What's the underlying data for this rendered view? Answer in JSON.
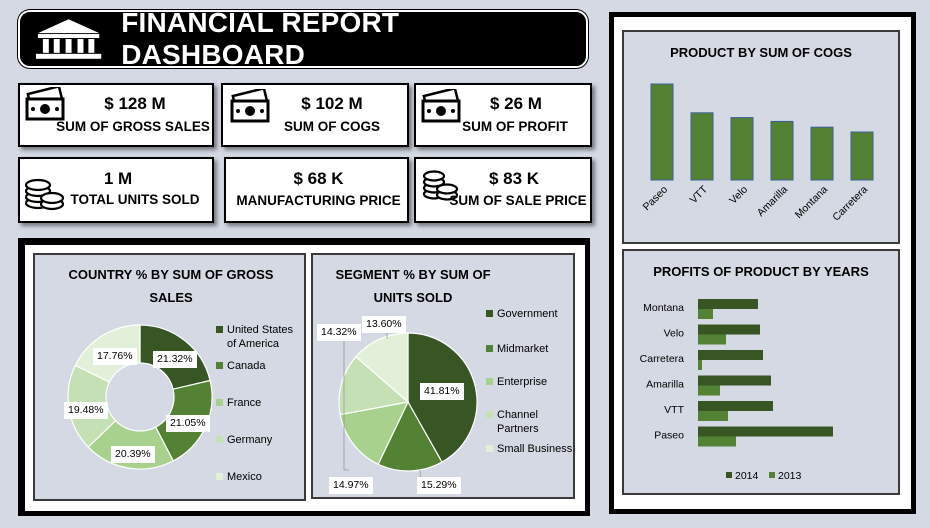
{
  "header": {
    "title": "FINANCIAL REPORT DASHBOARD"
  },
  "kpis": [
    {
      "value": "$ 128 M",
      "label": "SUM OF GROSS SALES",
      "icon": "cash-icon"
    },
    {
      "value": "$ 102 M",
      "label": "SUM OF COGS",
      "icon": "cash-icon"
    },
    {
      "value": "$ 26 M",
      "label": "SUM OF PROFIT",
      "icon": "cash-icon"
    },
    {
      "value": "1 M",
      "label": "TOTAL UNITS SOLD",
      "icon": "coins-icon"
    },
    {
      "value": "$ 68 K",
      "label": "MANUFACTURING PRICE",
      "icon": ""
    },
    {
      "value": "$ 83 K",
      "label": "SUM OF SALE PRICE",
      "icon": "coins-icon"
    }
  ],
  "chart_data": [
    {
      "type": "pie",
      "variant": "donut",
      "title": "COUNTRY % BY SUM OF GROSS SALES",
      "categories": [
        "United States of America",
        "Canada",
        "France",
        "Germany",
        "Mexico"
      ],
      "values": [
        21.32,
        21.05,
        20.39,
        19.48,
        17.76
      ],
      "data_labels": [
        "21.32%",
        "21.05%",
        "20.39%",
        "19.48%",
        "17.76%"
      ],
      "colors": [
        "#375623",
        "#548235",
        "#a9d18e",
        "#c5e0b4",
        "#e2f0d9"
      ],
      "legend_position": "right"
    },
    {
      "type": "pie",
      "title": "SEGMENT % BY SUM OF UNITS SOLD",
      "categories": [
        "Government",
        "Midmarket",
        "Enterprise",
        "Channel Partners",
        "Small Business"
      ],
      "values": [
        41.81,
        15.29,
        14.97,
        14.32,
        13.6
      ],
      "data_labels": [
        "41.81%",
        "15.29%",
        "14.97%",
        "14.32%",
        "13.60%"
      ],
      "colors": [
        "#375623",
        "#548235",
        "#a9d18e",
        "#c5e0b4",
        "#e2f0d9"
      ],
      "legend_position": "right"
    },
    {
      "type": "bar",
      "title": "PRODUCT BY SUM OF COGS",
      "categories": [
        "Paseo",
        "VTT",
        "Velo",
        "Amarilla",
        "Montana",
        "Carretera"
      ],
      "values": [
        100,
        70,
        65,
        61,
        55,
        50
      ],
      "axis_visible": false,
      "color": "#548235"
    },
    {
      "type": "bar",
      "orientation": "horizontal",
      "title": "PROFITS OF PRODUCT BY YEARS",
      "categories": [
        "Montana",
        "Velo",
        "Carretera",
        "Amarilla",
        "VTT",
        "Paseo"
      ],
      "series": [
        {
          "name": "2014",
          "values": [
            60,
            62,
            65,
            73,
            75,
            135
          ],
          "color": "#375623"
        },
        {
          "name": "2013",
          "values": [
            15,
            28,
            4,
            22,
            30,
            38
          ],
          "color": "#548235"
        }
      ],
      "legend_position": "bottom"
    }
  ]
}
